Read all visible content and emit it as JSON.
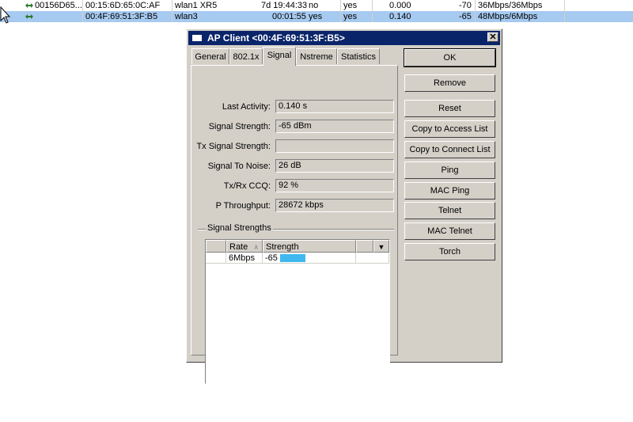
{
  "background_list": {
    "rows": [
      {
        "name": "00156D65...",
        "mac": "00:15:6D:65:0C:AF",
        "interface": "wlan1 XR5",
        "uptime": "7d 19:44:33",
        "ap": "no",
        "wds": "yes",
        "last_activity": "0.000",
        "signal": "-70",
        "rate": "36Mbps/36Mbps"
      },
      {
        "name": "",
        "mac": "00:4F:69:51:3F:B5",
        "interface": "wlan3",
        "uptime": "00:01:55",
        "ap": "yes",
        "wds": "yes",
        "last_activity": "0.140",
        "signal": "-65",
        "rate": "48Mbps/6Mbps"
      }
    ]
  },
  "dialog": {
    "title": "AP Client <00:4F:69:51:3F:B5>",
    "close_symbol": "✕",
    "tabs": [
      "General",
      "802.1x",
      "Signal",
      "Nstreme",
      "Statistics"
    ],
    "active_tab": "Signal",
    "fields": [
      {
        "label": "Last Activity:",
        "value": "0.140 s"
      },
      {
        "label": "Signal Strength:",
        "value": "-65 dBm"
      },
      {
        "label": "Tx Signal Strength:",
        "value": ""
      },
      {
        "label": "Signal To Noise:",
        "value": "26 dB"
      },
      {
        "label": "Tx/Rx CCQ:",
        "value": "92 %"
      },
      {
        "label": "P Throughput:",
        "value": "28672 kbps"
      }
    ],
    "signal_group_label": "Signal Strengths",
    "table": {
      "columns": [
        "Rate",
        "Strength"
      ],
      "sort_indicator": "∧",
      "dropdown_symbol": "▼",
      "rows": [
        {
          "rate": "6Mbps",
          "strength": "-65",
          "bar_level": 0.35
        }
      ]
    },
    "buttons": [
      "OK",
      "Remove",
      "Reset",
      "Copy to Access List",
      "Copy to Connect List",
      "Ping",
      "MAC Ping",
      "Telnet",
      "MAC Telnet",
      "Torch"
    ]
  },
  "colors": {
    "selection": "#a6caf0",
    "titlebar": "#0a246a",
    "bar": "#3fb8ef"
  }
}
